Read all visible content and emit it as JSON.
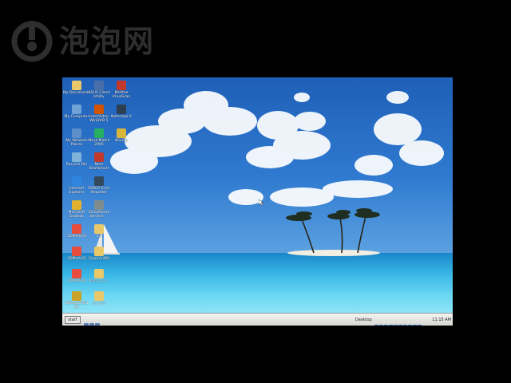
{
  "watermark": {
    "text": "泡泡网",
    "icon": "power-logo-icon"
  },
  "desktop": {
    "icons": [
      {
        "label": "My Documents",
        "icon": "folder-documents-icon",
        "color": "#e9c86a"
      },
      {
        "label": "ASUS Client Utility",
        "icon": "utility-icon",
        "color": "#4a6fa8"
      },
      {
        "label": "McAfee VirusScan",
        "icon": "shield-icon",
        "color": "#c0392b"
      },
      {
        "label": "My Computer",
        "icon": "computer-icon",
        "color": "#6fa3d8"
      },
      {
        "label": "InterVideo WinDVD 5",
        "icon": "dvd-icon",
        "color": "#d35400"
      },
      {
        "label": "Netscape 6",
        "icon": "netscape-icon",
        "color": "#2c3e50"
      },
      {
        "label": "My Network Places",
        "icon": "network-icon",
        "color": "#5d8fc9"
      },
      {
        "label": "MusicMatch 2005",
        "icon": "musicmatch-icon",
        "color": "#27ae60"
      },
      {
        "label": "WinZip",
        "icon": "winzip-icon",
        "color": "#d8b43a"
      },
      {
        "label": "Recycle Bin",
        "icon": "recycle-bin-icon",
        "color": "#7fb2d8"
      },
      {
        "label": "Nero StartSmart",
        "icon": "nero-icon",
        "color": "#c0392b"
      },
      {
        "label": "Internet Explorer",
        "icon": "internet-explorer-icon",
        "color": "#2e86de"
      },
      {
        "label": "SERCP Error Reporter",
        "icon": "error-reporter-icon",
        "color": "#34495e"
      },
      {
        "label": "Microsoft Outlook",
        "icon": "outlook-icon",
        "color": "#e1b12c"
      },
      {
        "label": "SGSoftware Service ...",
        "icon": "service-icon",
        "color": "#7f8c8d"
      },
      {
        "label": "3DMark03",
        "icon": "3dmark-icon",
        "color": "#e74c3c"
      },
      {
        "label": "3.0",
        "icon": "folder-icon",
        "color": "#e9c86a"
      },
      {
        "label": "3DMark05",
        "icon": "3dmark-icon",
        "color": "#e74c3c"
      },
      {
        "label": "Doom3 MD",
        "icon": "folder-icon",
        "color": "#e9c86a"
      },
      {
        "label": "3DMark06",
        "icon": "3dmark-icon",
        "color": "#e74c3c"
      },
      {
        "label": "nsm_zl_h...",
        "icon": "folder-icon",
        "color": "#e9c86a"
      },
      {
        "label": "3DMark2001 SE",
        "icon": "3dmark-icon",
        "color": "#c9a227"
      },
      {
        "label": "□□□□",
        "icon": "folder-icon",
        "color": "#e9c86a"
      }
    ]
  },
  "taskbar": {
    "start_label": "start",
    "desktop_label": "Desktop",
    "clock": "11:15 AM",
    "colors": {
      "bar": "#e4e4e0",
      "accent": "#3a6fb0"
    }
  },
  "wallpaper": {
    "description_colors": {
      "sky": "#2f7ad0",
      "sea": "#38b6e6",
      "sand": "#f2efe2"
    }
  }
}
